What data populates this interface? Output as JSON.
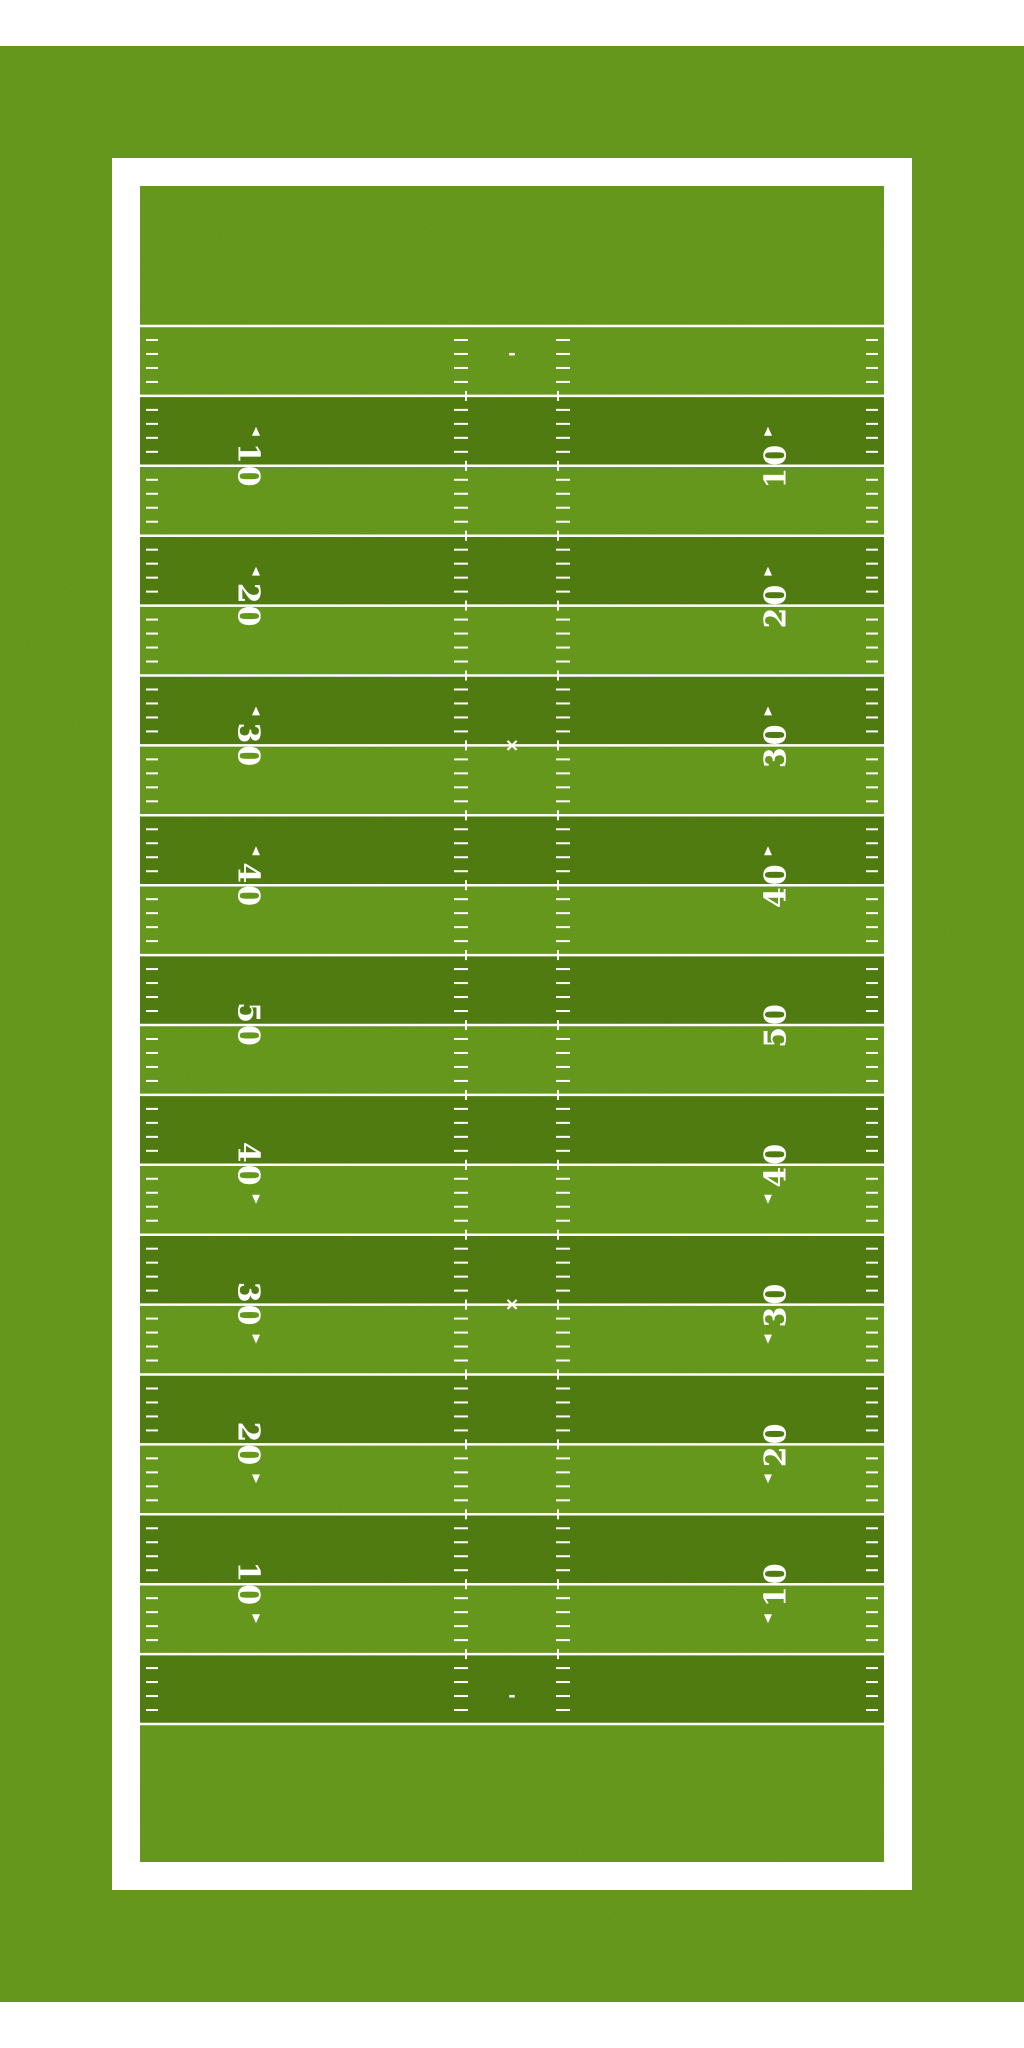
{
  "field": {
    "colors": {
      "background": "#ffffff",
      "grass_light": "#5f9318",
      "grass_dark": "#4b760f",
      "line": "#ffffff"
    },
    "yard_numbers": [
      "10",
      "20",
      "30",
      "40",
      "50",
      "40",
      "30",
      "20",
      "10"
    ],
    "markers": {
      "pat_mark": "-",
      "yardline_mark": "×"
    }
  }
}
